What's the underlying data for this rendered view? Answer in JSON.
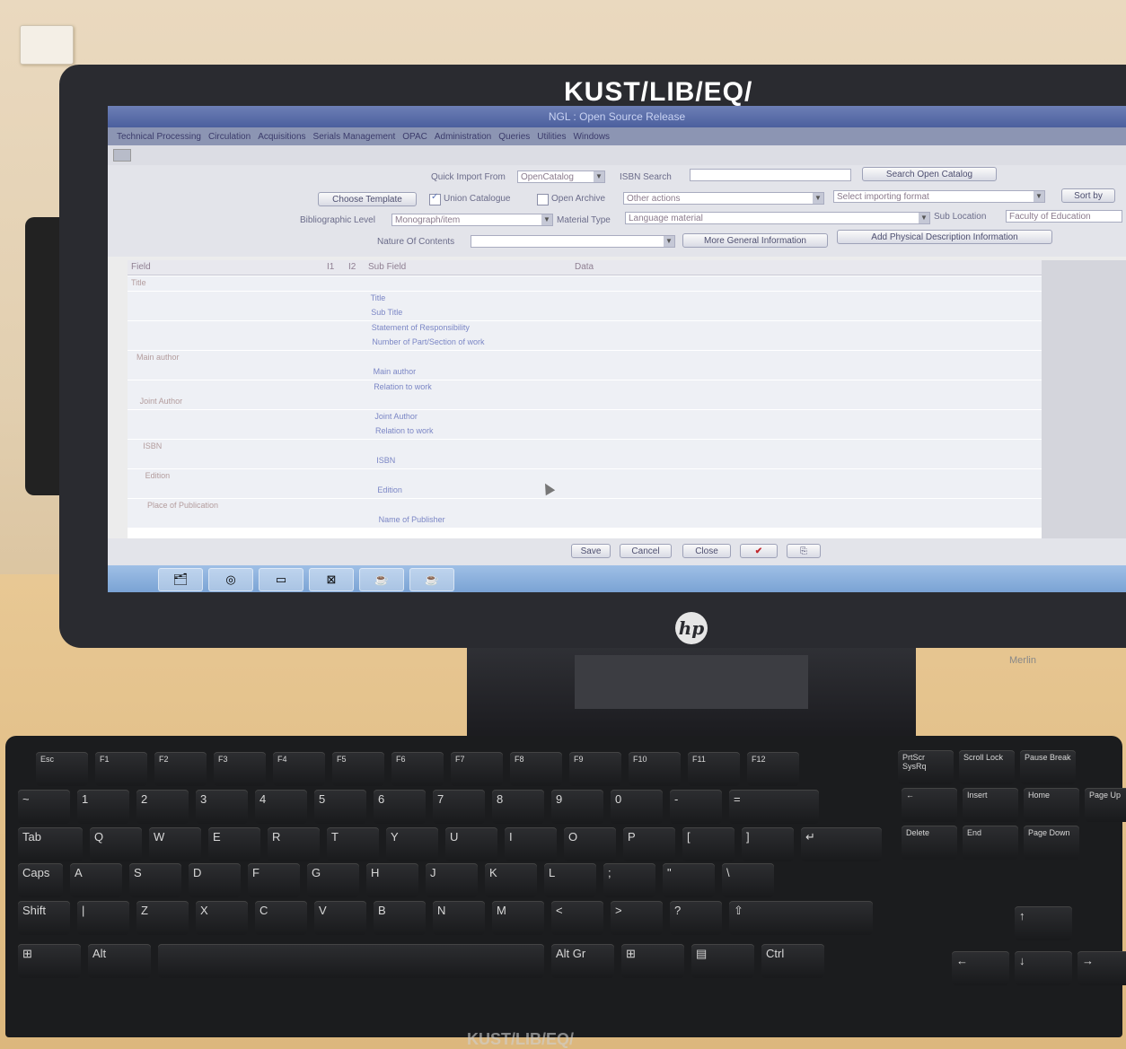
{
  "monitor_label": "KUST/LIB/EQ/",
  "monitor_brand": "Merlin",
  "app": {
    "title": "NGL : Open Source Release",
    "menu": [
      "Technical Processing",
      "Circulation",
      "Acquisitions",
      "Serials Management",
      "OPAC",
      "Administration",
      "Queries",
      "Utilities",
      "Windows"
    ]
  },
  "form": {
    "quick_import_label": "Quick Import From",
    "quick_import_value": "OpenCatalog",
    "isbn_search_label": "ISBN Search",
    "search_open_catalog": "Search Open Catalog",
    "choose_template": "Choose Template",
    "union_catalogue": "Union Catalogue",
    "open_archive": "Open Archive",
    "other_actions": "Other actions",
    "select_importing_format": "Select importing format",
    "sort_by": "Sort by",
    "bibliographic_level_label": "Bibliographic Level",
    "bibliographic_level_value": "Monograph/item",
    "material_type_label": "Material Type",
    "material_type_value": "Language material",
    "sub_location_label": "Sub Location",
    "sub_location_value": "Faculty of Education",
    "nature_of_contents_label": "Nature Of Contents",
    "more_general_information": "More General Information",
    "add_physical_description": "Add Physical Description Information"
  },
  "grid": {
    "headers": [
      "Field",
      "I1",
      "I2",
      "Sub Field",
      "Data"
    ],
    "rows": [
      {
        "field": "Title",
        "sub": ""
      },
      {
        "field": "",
        "sub": "Title"
      },
      {
        "field": "",
        "sub": "Sub Title"
      },
      {
        "field": "",
        "sub": "Statement of Responsibility"
      },
      {
        "field": "",
        "sub": "Number of Part/Section of work"
      },
      {
        "field": "Main author",
        "sub": ""
      },
      {
        "field": "",
        "sub": "Main author"
      },
      {
        "field": "",
        "sub": "Relation to work"
      },
      {
        "field": "Joint Author",
        "sub": ""
      },
      {
        "field": "",
        "sub": "Joint Author"
      },
      {
        "field": "",
        "sub": "Relation to work"
      },
      {
        "field": "ISBN",
        "sub": ""
      },
      {
        "field": "",
        "sub": "ISBN"
      },
      {
        "field": "Edition",
        "sub": ""
      },
      {
        "field": "",
        "sub": "Edition"
      },
      {
        "field": "Place of Publication",
        "sub": ""
      },
      {
        "field": "",
        "sub": "Name of Publisher"
      }
    ]
  },
  "bottom_buttons": {
    "save": "Save",
    "cancel": "Cancel",
    "close": "Close",
    "check": "✔",
    "extra": "⎘"
  },
  "taskbar_icons": [
    "windows-explorer",
    "chrome",
    "folder",
    "xampp",
    "java",
    "java"
  ],
  "keyboard": {
    "fn_row": [
      "Esc",
      "F1",
      "F2",
      "F3",
      "F4",
      "F5",
      "F6",
      "F7",
      "F8",
      "F9",
      "F10",
      "F11",
      "F12",
      "PrtScr SysRq",
      "Scroll Lock",
      "Pause Break"
    ],
    "num_row": [
      "~",
      "1",
      "2",
      "3",
      "4",
      "5",
      "6",
      "7",
      "8",
      "9",
      "0",
      "-",
      "=",
      "←",
      "Insert",
      "Home",
      "Page Up"
    ],
    "q_row": [
      "Tab",
      "Q",
      "W",
      "E",
      "R",
      "T",
      "Y",
      "U",
      "I",
      "O",
      "P",
      "[",
      "]",
      "↵",
      "Delete",
      "End",
      "Page Down"
    ],
    "a_row": [
      "Caps",
      "A",
      "S",
      "D",
      "F",
      "G",
      "H",
      "J",
      "K",
      "L",
      ";",
      "\"",
      "\\"
    ],
    "z_row": [
      "Shift",
      "|",
      "Z",
      "X",
      "C",
      "V",
      "B",
      "N",
      "M",
      "<",
      ">",
      "?",
      "⇧"
    ],
    "bottom_row": [
      "⊞",
      "Alt",
      "",
      "Alt Gr",
      "⊞",
      "▤",
      "Ctrl"
    ],
    "arrows": [
      "↑",
      "←",
      "↓",
      "→"
    ],
    "brand": "KUST/LIB/EQ/"
  }
}
